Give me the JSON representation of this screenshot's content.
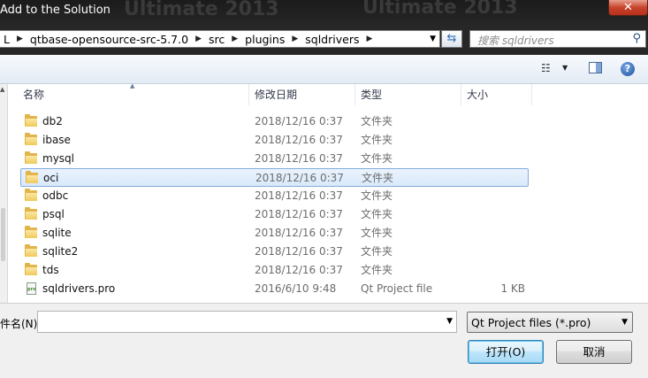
{
  "window": {
    "title": "Add to the Solution",
    "close_glyph": "✕",
    "background_watermark_left": "Ultimate 2013",
    "background_watermark_right": "Ultimate 2013"
  },
  "address_bar": {
    "breadcrumbs": [
      "L",
      "qtbase-opensource-src-5.7.0",
      "src",
      "plugins",
      "sqldrivers"
    ],
    "search_placeholder": "搜索 sqldrivers"
  },
  "toolbar": {
    "view_icon": "list-view-icon",
    "pane_icon": "preview-pane-icon",
    "help_glyph": "?"
  },
  "columns": {
    "name": "名称",
    "date": "修改日期",
    "type": "类型",
    "size": "大小"
  },
  "files": [
    {
      "name": "db2",
      "date": "2018/12/16 0:37",
      "type": "文件夹",
      "size": "",
      "icon": "folder-icon"
    },
    {
      "name": "ibase",
      "date": "2018/12/16 0:37",
      "type": "文件夹",
      "size": "",
      "icon": "folder-icon"
    },
    {
      "name": "mysql",
      "date": "2018/12/16 0:37",
      "type": "文件夹",
      "size": "",
      "icon": "folder-icon"
    },
    {
      "name": "oci",
      "date": "2018/12/16 0:37",
      "type": "文件夹",
      "size": "",
      "icon": "folder-icon",
      "selected": true
    },
    {
      "name": "odbc",
      "date": "2018/12/16 0:37",
      "type": "文件夹",
      "size": "",
      "icon": "folder-icon"
    },
    {
      "name": "psql",
      "date": "2018/12/16 0:37",
      "type": "文件夹",
      "size": "",
      "icon": "folder-icon"
    },
    {
      "name": "sqlite",
      "date": "2018/12/16 0:37",
      "type": "文件夹",
      "size": "",
      "icon": "folder-icon"
    },
    {
      "name": "sqlite2",
      "date": "2018/12/16 0:37",
      "type": "文件夹",
      "size": "",
      "icon": "folder-icon"
    },
    {
      "name": "tds",
      "date": "2018/12/16 0:37",
      "type": "文件夹",
      "size": "",
      "icon": "folder-icon"
    },
    {
      "name": "sqldrivers.pro",
      "date": "2016/6/10 9:48",
      "type": "Qt Project file",
      "size": "1 KB",
      "icon": "pro-file-icon"
    }
  ],
  "footer": {
    "filename_label": "件名(N):",
    "filename_value": "",
    "filetype_selected": "Qt Project files (*.pro)",
    "open_button": "打开(O)",
    "cancel_button": "取消"
  }
}
